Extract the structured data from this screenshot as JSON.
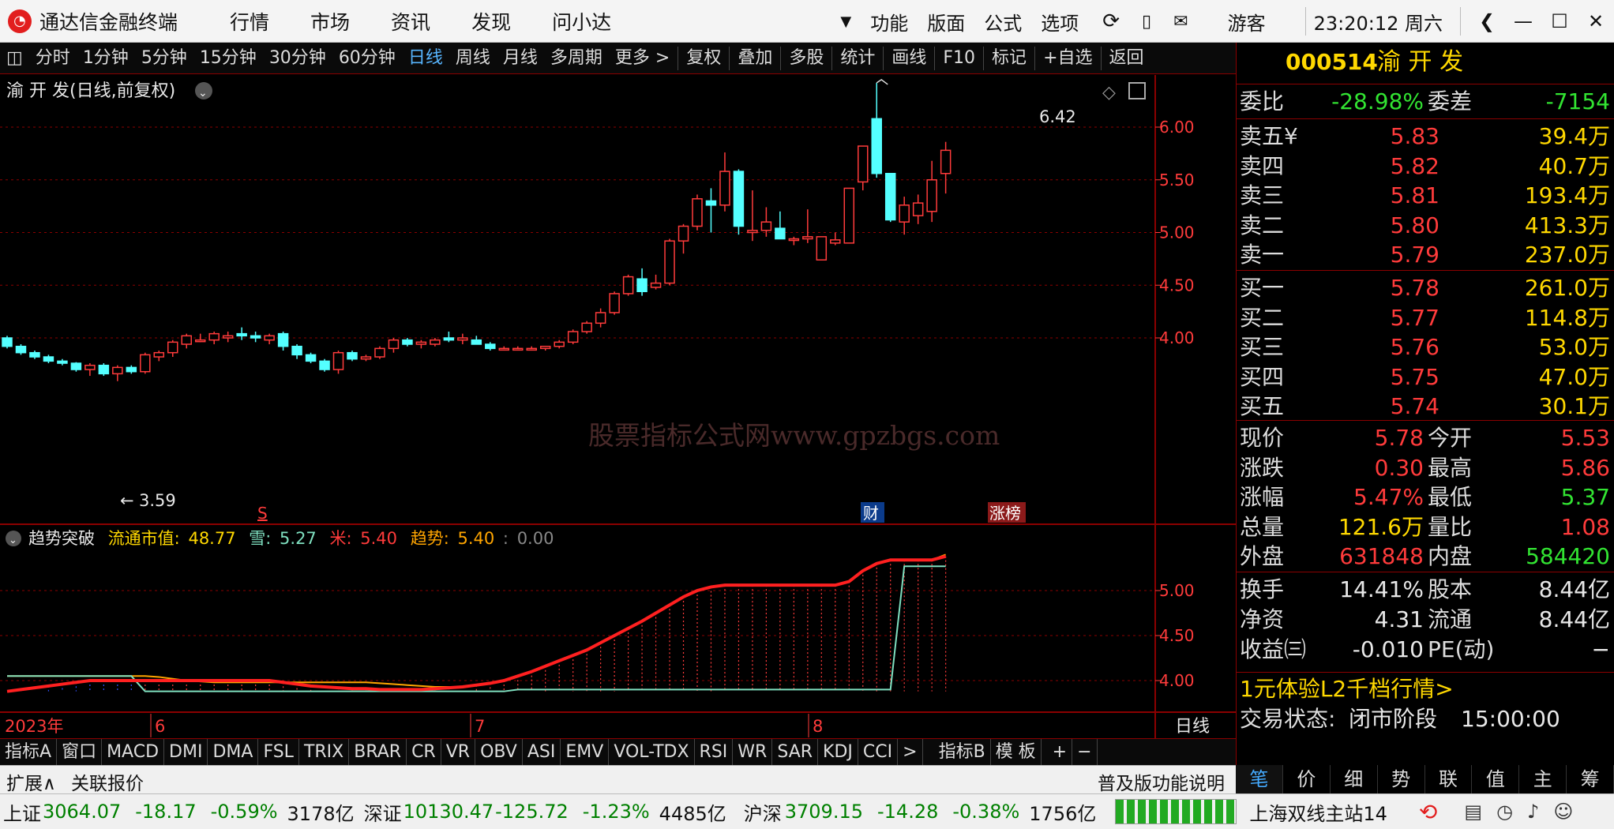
{
  "window": {
    "app_title": "通达信金融终端",
    "menu": [
      "行情",
      "市场",
      "资讯",
      "发现",
      "问小达"
    ],
    "right_menu": [
      "功能",
      "版面",
      "公式",
      "选项"
    ],
    "user": "游客",
    "clock": "23:20:12 周六"
  },
  "toolbar": {
    "periods": [
      "分时",
      "1分钟",
      "5分钟",
      "15分钟",
      "30分钟",
      "60分钟",
      "日线",
      "周线",
      "月线",
      "多周期",
      "更多 >"
    ],
    "active": "日线",
    "actions": [
      "复权",
      "叠加",
      "多股",
      "统计",
      "画线",
      "F10",
      "标记",
      "+自选",
      "返回"
    ]
  },
  "main_chart": {
    "title": "渝 开 发(日线,前复权)",
    "high_label": "6.42",
    "low_label": "3.59",
    "watermark": "股票指标公式网www.gpzbgs.com",
    "event_markers": [
      "S",
      "财",
      "涨榜"
    ]
  },
  "indicator": {
    "title": "趋势突破",
    "labels": [
      {
        "name": "流通市值:",
        "value": "48.77",
        "color": "#ffd800"
      },
      {
        "name": "雪:",
        "value": "5.27",
        "color": "#7fe0c0"
      },
      {
        "name": "米:",
        "value": "5.40",
        "color": "#ff3b3b"
      },
      {
        "name": "趋势:",
        "value": "5.40",
        "color": "#ffa500"
      },
      {
        "name": ":",
        "value": "0.00",
        "color": "#888888"
      }
    ]
  },
  "x_axis": {
    "labels": [
      "2023年",
      "6",
      "7",
      "8"
    ],
    "period_label": "日线"
  },
  "chart_data": [
    {
      "type": "candlestick",
      "name": "渝 开 发",
      "x": [
        "d1",
        "d2",
        "d3",
        "d4",
        "d5",
        "d6",
        "d7",
        "d8",
        "d9",
        "d10",
        "d11",
        "d12",
        "d13",
        "d14",
        "d15",
        "d16",
        "d17",
        "d18",
        "d19",
        "d20",
        "d21",
        "d22",
        "d23",
        "d24",
        "d25",
        "d26",
        "d27",
        "d28",
        "d29",
        "d30",
        "d31",
        "d32",
        "d33",
        "d34",
        "d35",
        "d36",
        "d37",
        "d38",
        "d39",
        "d40",
        "d41",
        "d42",
        "d43",
        "d44",
        "d45",
        "d46",
        "d47",
        "d48",
        "d49",
        "d50",
        "d51",
        "d52",
        "d53",
        "d54",
        "d55",
        "d56",
        "d57",
        "d58",
        "d59",
        "d60",
        "d61",
        "d62",
        "d63",
        "d64",
        "d65",
        "d66",
        "d67",
        "d68",
        "d69"
      ],
      "ohlc": [
        [
          4.0,
          4.02,
          3.9,
          3.92
        ],
        [
          3.92,
          3.94,
          3.84,
          3.86
        ],
        [
          3.86,
          3.88,
          3.8,
          3.82
        ],
        [
          3.82,
          3.84,
          3.76,
          3.78
        ],
        [
          3.78,
          3.8,
          3.74,
          3.76
        ],
        [
          3.76,
          3.77,
          3.68,
          3.7
        ],
        [
          3.7,
          3.76,
          3.64,
          3.74
        ],
        [
          3.74,
          3.76,
          3.64,
          3.66
        ],
        [
          3.66,
          3.74,
          3.59,
          3.72
        ],
        [
          3.72,
          3.74,
          3.66,
          3.68
        ],
        [
          3.68,
          3.86,
          3.66,
          3.84
        ],
        [
          3.82,
          3.88,
          3.78,
          3.86
        ],
        [
          3.86,
          3.98,
          3.82,
          3.96
        ],
        [
          3.94,
          4.04,
          3.9,
          4.02
        ],
        [
          3.98,
          4.04,
          3.96,
          3.98
        ],
        [
          3.98,
          4.06,
          3.94,
          4.04
        ],
        [
          4.0,
          4.06,
          3.96,
          4.02
        ],
        [
          4.04,
          4.1,
          3.98,
          4.02
        ],
        [
          4.02,
          4.06,
          3.96,
          4.0
        ],
        [
          3.98,
          4.04,
          3.94,
          4.02
        ],
        [
          4.04,
          4.06,
          3.88,
          3.92
        ],
        [
          3.92,
          3.94,
          3.8,
          3.84
        ],
        [
          3.84,
          3.86,
          3.76,
          3.78
        ],
        [
          3.78,
          3.8,
          3.68,
          3.7
        ],
        [
          3.7,
          3.88,
          3.66,
          3.86
        ],
        [
          3.86,
          3.88,
          3.78,
          3.8
        ],
        [
          3.8,
          3.84,
          3.78,
          3.82
        ],
        [
          3.82,
          3.92,
          3.8,
          3.9
        ],
        [
          3.9,
          4.0,
          3.86,
          3.98
        ],
        [
          3.98,
          4.0,
          3.92,
          3.94
        ],
        [
          3.94,
          3.98,
          3.9,
          3.96
        ],
        [
          3.94,
          4.0,
          3.92,
          3.98
        ],
        [
          4.0,
          4.06,
          3.96,
          3.98
        ],
        [
          3.98,
          4.04,
          3.94,
          4.0
        ],
        [
          3.98,
          4.02,
          3.94,
          3.94
        ],
        [
          3.94,
          3.96,
          3.88,
          3.9
        ],
        [
          3.9,
          3.92,
          3.88,
          3.9
        ],
        [
          3.9,
          3.92,
          3.88,
          3.9
        ],
        [
          3.9,
          3.92,
          3.88,
          3.9
        ],
        [
          3.9,
          3.92,
          3.88,
          3.92
        ],
        [
          3.92,
          3.98,
          3.9,
          3.96
        ],
        [
          3.96,
          4.08,
          3.94,
          4.06
        ],
        [
          4.06,
          4.16,
          4.04,
          4.14
        ],
        [
          4.14,
          4.28,
          4.1,
          4.24
        ],
        [
          4.24,
          4.44,
          4.22,
          4.42
        ],
        [
          4.42,
          4.6,
          4.4,
          4.58
        ],
        [
          4.56,
          4.66,
          4.4,
          4.44
        ],
        [
          4.48,
          4.6,
          4.46,
          4.52
        ],
        [
          4.52,
          4.94,
          4.5,
          4.92
        ],
        [
          4.92,
          5.08,
          4.8,
          5.06
        ],
        [
          5.06,
          5.36,
          5.02,
          5.32
        ],
        [
          5.3,
          5.42,
          5.0,
          5.26
        ],
        [
          5.26,
          5.76,
          5.2,
          5.58
        ],
        [
          5.58,
          5.6,
          4.98,
          5.06
        ],
        [
          5.0,
          5.4,
          4.92,
          5.02
        ],
        [
          5.02,
          5.24,
          4.96,
          5.1
        ],
        [
          5.04,
          5.2,
          4.94,
          4.94
        ],
        [
          4.94,
          4.96,
          4.88,
          4.94
        ],
        [
          4.94,
          5.22,
          4.9,
          4.96
        ],
        [
          4.74,
          4.96,
          4.74,
          4.96
        ],
        [
          4.9,
          5.0,
          4.88,
          4.93
        ],
        [
          4.9,
          5.42,
          4.9,
          5.42
        ],
        [
          5.48,
          5.82,
          5.4,
          5.82
        ],
        [
          6.08,
          6.42,
          5.52,
          5.56
        ],
        [
          5.56,
          5.56,
          5.1,
          5.12
        ],
        [
          5.1,
          5.34,
          4.98,
          5.26
        ],
        [
          5.16,
          5.36,
          5.08,
          5.28
        ],
        [
          5.2,
          5.68,
          5.1,
          5.5
        ],
        [
          5.56,
          5.86,
          5.37,
          5.78
        ]
      ],
      "ylim": [
        3.5,
        6.5
      ],
      "yticks": [
        4.0,
        4.5,
        5.0,
        5.5,
        6.0
      ]
    },
    {
      "type": "line",
      "name": "趋势突破",
      "ylim": [
        3.8,
        5.8
      ],
      "yticks": [
        4.0,
        4.5,
        5.0
      ],
      "series": [
        {
          "name": "米",
          "color": "#ff2020",
          "values": [
            3.88,
            3.9,
            3.92,
            3.94,
            3.96,
            3.98,
            4.0,
            4.0,
            4.0,
            4.0,
            4.0,
            4.0,
            4.0,
            4.0,
            4.0,
            4.0,
            4.0,
            4.0,
            4.0,
            4.0,
            3.98,
            3.96,
            3.94,
            3.93,
            3.92,
            3.91,
            3.91,
            3.9,
            3.9,
            3.9,
            3.9,
            3.91,
            3.92,
            3.93,
            3.95,
            3.97,
            4.0,
            4.05,
            4.1,
            4.16,
            4.22,
            4.28,
            4.34,
            4.42,
            4.5,
            4.58,
            4.66,
            4.75,
            4.84,
            4.93,
            5.0,
            5.04,
            5.06,
            5.06,
            5.06,
            5.06,
            5.06,
            5.06,
            5.06,
            5.06,
            5.06,
            5.1,
            5.22,
            5.3,
            5.34,
            5.34,
            5.34,
            5.34,
            5.38
          ]
        },
        {
          "name": "雪",
          "color": "#7fe0c0",
          "values": [
            4.05,
            4.05,
            4.05,
            4.05,
            4.05,
            4.05,
            4.05,
            4.05,
            4.05,
            4.05,
            3.88,
            3.88,
            3.88,
            3.88,
            3.88,
            3.88,
            3.88,
            3.88,
            3.88,
            3.88,
            3.88,
            3.88,
            3.88,
            3.88,
            3.88,
            3.88,
            3.88,
            3.88,
            3.88,
            3.88,
            3.88,
            3.88,
            3.88,
            3.88,
            3.88,
            3.88,
            3.88,
            3.9,
            3.9,
            3.9,
            3.9,
            3.9,
            3.9,
            3.9,
            3.9,
            3.9,
            3.9,
            3.9,
            3.9,
            3.9,
            3.9,
            3.9,
            3.9,
            3.9,
            3.9,
            3.9,
            3.9,
            3.9,
            3.9,
            3.9,
            3.9,
            3.9,
            3.9,
            3.9,
            3.9,
            5.27,
            5.27,
            5.27,
            5.27
          ]
        },
        {
          "name": "趋势",
          "color": "#ffa500",
          "values": [
            4.05,
            4.05,
            4.05,
            4.05,
            4.05,
            4.05,
            4.05,
            4.05,
            4.05,
            4.05,
            4.05,
            4.04,
            4.02,
            4.0,
            3.99,
            3.98,
            3.98,
            3.98,
            3.98,
            3.98,
            3.98,
            3.98,
            3.98,
            3.98,
            3.98,
            3.98,
            3.98,
            3.97,
            3.96,
            3.95,
            3.94,
            3.93,
            3.93,
            3.93,
            3.95,
            3.97,
            4.0,
            4.05,
            4.1,
            4.16,
            4.22,
            4.28,
            4.34,
            4.42,
            4.5,
            4.58,
            4.66,
            4.75,
            4.84,
            4.93,
            5.0,
            5.04,
            5.06,
            5.06,
            5.06,
            5.06,
            5.06,
            5.06,
            5.06,
            5.06,
            5.06,
            5.1,
            5.22,
            5.3,
            5.34,
            5.34,
            5.34,
            5.34,
            5.4
          ]
        }
      ]
    }
  ],
  "quote_panel": {
    "code": "000514",
    "name": "渝 开 发",
    "wei_bi_label": "委比",
    "wei_bi": "-28.98%",
    "wei_cha_label": "委差",
    "wei_cha": "-7154",
    "asks": [
      {
        "label": "卖五",
        "mark": "¥",
        "price": "5.83",
        "vol": "39.4万"
      },
      {
        "label": "卖四",
        "mark": "",
        "price": "5.82",
        "vol": "40.7万"
      },
      {
        "label": "卖三",
        "mark": "",
        "price": "5.81",
        "vol": "193.4万"
      },
      {
        "label": "卖二",
        "mark": "",
        "price": "5.80",
        "vol": "413.3万"
      },
      {
        "label": "卖一",
        "mark": "",
        "price": "5.79",
        "vol": "237.0万"
      }
    ],
    "bids": [
      {
        "label": "买一",
        "price": "5.78",
        "vol": "261.0万"
      },
      {
        "label": "买二",
        "price": "5.77",
        "vol": "114.8万"
      },
      {
        "label": "买三",
        "price": "5.76",
        "vol": "53.0万"
      },
      {
        "label": "买四",
        "price": "5.75",
        "vol": "47.0万"
      },
      {
        "label": "买五",
        "price": "5.74",
        "vol": "30.1万"
      }
    ],
    "stats": [
      {
        "l1": "现价",
        "v1": "5.78",
        "c1": "red",
        "l2": "今开",
        "v2": "5.53",
        "c2": "red"
      },
      {
        "l1": "涨跌",
        "v1": "0.30",
        "c1": "red",
        "l2": "最高",
        "v2": "5.86",
        "c2": "red"
      },
      {
        "l1": "涨幅",
        "v1": "5.47%",
        "c1": "red",
        "l2": "最低",
        "v2": "5.37",
        "c2": "green"
      },
      {
        "l1": "总量",
        "v1": "121.6万",
        "c1": "yellow",
        "l2": "量比",
        "v2": "1.08",
        "c2": "red"
      },
      {
        "l1": "外盘",
        "v1": "631848",
        "c1": "red",
        "l2": "内盘",
        "v2": "584420",
        "c2": "green"
      }
    ],
    "stats2": [
      {
        "l1": "换手",
        "v1": "14.41%",
        "l2": "股本",
        "v2": "8.44亿"
      },
      {
        "l1": "净资",
        "v1": "4.31",
        "l2": "流通",
        "v2": "8.44亿"
      },
      {
        "l1": "收益㈢",
        "v1": "-0.010",
        "l2": "PE(动)",
        "v2": "−"
      }
    ],
    "promo": "1元体验L2千档行情>",
    "trade_state_label": "交易状态:",
    "trade_state": "闭市阶段",
    "trade_time": "15:00:00",
    "tabs": [
      "笔",
      "价",
      "细",
      "势",
      "联",
      "值",
      "主",
      "筹"
    ]
  },
  "bottom_tabs": [
    "指标A",
    "窗口",
    "MACD",
    "DMI",
    "DMA",
    "FSL",
    "TRIX",
    "BRAR",
    "CR",
    "VR",
    "OBV",
    "ASI",
    "EMV",
    "VOL-TDX",
    "RSI",
    "WR",
    "SAR",
    "KDJ",
    "CCI",
    ">",
    "指标B",
    "模 板",
    "+",
    "−"
  ],
  "ext_bar": {
    "expand": "扩展∧",
    "related": "关联报价",
    "help": "普及版功能说明"
  },
  "status_bar": {
    "items": [
      {
        "name": "上证",
        "v": "3064.07",
        "c": "-18.17",
        "p": "-0.59%",
        "amt": "3178亿"
      },
      {
        "name": "深证",
        "v": "10130.47",
        "c": "-125.72",
        "p": "-1.23%",
        "amt": "4485亿"
      },
      {
        "name": "沪深",
        "v": "3709.15",
        "c": "-14.28",
        "p": "-0.38%",
        "amt": "1756亿"
      }
    ],
    "server": "上海双线主站14"
  },
  "colors": {
    "up": "#ff3b3b",
    "down": "#54ffff",
    "grid": "#8b0000",
    "axis": "#ff3b3b"
  }
}
